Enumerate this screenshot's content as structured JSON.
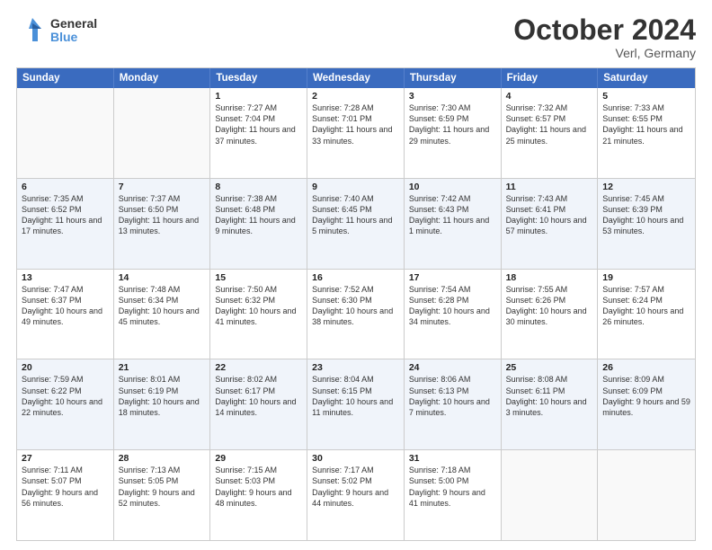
{
  "header": {
    "logo_general": "General",
    "logo_blue": "Blue",
    "main_title": "October 2024",
    "subtitle": "Verl, Germany"
  },
  "days_of_week": [
    "Sunday",
    "Monday",
    "Tuesday",
    "Wednesday",
    "Thursday",
    "Friday",
    "Saturday"
  ],
  "weeks": [
    [
      {
        "day": "",
        "info": "",
        "empty": true
      },
      {
        "day": "",
        "info": "",
        "empty": true
      },
      {
        "day": "1",
        "info": "Sunrise: 7:27 AM\nSunset: 7:04 PM\nDaylight: 11 hours and 37 minutes."
      },
      {
        "day": "2",
        "info": "Sunrise: 7:28 AM\nSunset: 7:01 PM\nDaylight: 11 hours and 33 minutes."
      },
      {
        "day": "3",
        "info": "Sunrise: 7:30 AM\nSunset: 6:59 PM\nDaylight: 11 hours and 29 minutes."
      },
      {
        "day": "4",
        "info": "Sunrise: 7:32 AM\nSunset: 6:57 PM\nDaylight: 11 hours and 25 minutes."
      },
      {
        "day": "5",
        "info": "Sunrise: 7:33 AM\nSunset: 6:55 PM\nDaylight: 11 hours and 21 minutes."
      }
    ],
    [
      {
        "day": "6",
        "info": "Sunrise: 7:35 AM\nSunset: 6:52 PM\nDaylight: 11 hours and 17 minutes."
      },
      {
        "day": "7",
        "info": "Sunrise: 7:37 AM\nSunset: 6:50 PM\nDaylight: 11 hours and 13 minutes."
      },
      {
        "day": "8",
        "info": "Sunrise: 7:38 AM\nSunset: 6:48 PM\nDaylight: 11 hours and 9 minutes."
      },
      {
        "day": "9",
        "info": "Sunrise: 7:40 AM\nSunset: 6:45 PM\nDaylight: 11 hours and 5 minutes."
      },
      {
        "day": "10",
        "info": "Sunrise: 7:42 AM\nSunset: 6:43 PM\nDaylight: 11 hours and 1 minute."
      },
      {
        "day": "11",
        "info": "Sunrise: 7:43 AM\nSunset: 6:41 PM\nDaylight: 10 hours and 57 minutes."
      },
      {
        "day": "12",
        "info": "Sunrise: 7:45 AM\nSunset: 6:39 PM\nDaylight: 10 hours and 53 minutes."
      }
    ],
    [
      {
        "day": "13",
        "info": "Sunrise: 7:47 AM\nSunset: 6:37 PM\nDaylight: 10 hours and 49 minutes."
      },
      {
        "day": "14",
        "info": "Sunrise: 7:48 AM\nSunset: 6:34 PM\nDaylight: 10 hours and 45 minutes."
      },
      {
        "day": "15",
        "info": "Sunrise: 7:50 AM\nSunset: 6:32 PM\nDaylight: 10 hours and 41 minutes."
      },
      {
        "day": "16",
        "info": "Sunrise: 7:52 AM\nSunset: 6:30 PM\nDaylight: 10 hours and 38 minutes."
      },
      {
        "day": "17",
        "info": "Sunrise: 7:54 AM\nSunset: 6:28 PM\nDaylight: 10 hours and 34 minutes."
      },
      {
        "day": "18",
        "info": "Sunrise: 7:55 AM\nSunset: 6:26 PM\nDaylight: 10 hours and 30 minutes."
      },
      {
        "day": "19",
        "info": "Sunrise: 7:57 AM\nSunset: 6:24 PM\nDaylight: 10 hours and 26 minutes."
      }
    ],
    [
      {
        "day": "20",
        "info": "Sunrise: 7:59 AM\nSunset: 6:22 PM\nDaylight: 10 hours and 22 minutes."
      },
      {
        "day": "21",
        "info": "Sunrise: 8:01 AM\nSunset: 6:19 PM\nDaylight: 10 hours and 18 minutes."
      },
      {
        "day": "22",
        "info": "Sunrise: 8:02 AM\nSunset: 6:17 PM\nDaylight: 10 hours and 14 minutes."
      },
      {
        "day": "23",
        "info": "Sunrise: 8:04 AM\nSunset: 6:15 PM\nDaylight: 10 hours and 11 minutes."
      },
      {
        "day": "24",
        "info": "Sunrise: 8:06 AM\nSunset: 6:13 PM\nDaylight: 10 hours and 7 minutes."
      },
      {
        "day": "25",
        "info": "Sunrise: 8:08 AM\nSunset: 6:11 PM\nDaylight: 10 hours and 3 minutes."
      },
      {
        "day": "26",
        "info": "Sunrise: 8:09 AM\nSunset: 6:09 PM\nDaylight: 9 hours and 59 minutes."
      }
    ],
    [
      {
        "day": "27",
        "info": "Sunrise: 7:11 AM\nSunset: 5:07 PM\nDaylight: 9 hours and 56 minutes."
      },
      {
        "day": "28",
        "info": "Sunrise: 7:13 AM\nSunset: 5:05 PM\nDaylight: 9 hours and 52 minutes."
      },
      {
        "day": "29",
        "info": "Sunrise: 7:15 AM\nSunset: 5:03 PM\nDaylight: 9 hours and 48 minutes."
      },
      {
        "day": "30",
        "info": "Sunrise: 7:17 AM\nSunset: 5:02 PM\nDaylight: 9 hours and 44 minutes."
      },
      {
        "day": "31",
        "info": "Sunrise: 7:18 AM\nSunset: 5:00 PM\nDaylight: 9 hours and 41 minutes."
      },
      {
        "day": "",
        "info": "",
        "empty": true
      },
      {
        "day": "",
        "info": "",
        "empty": true
      }
    ]
  ]
}
